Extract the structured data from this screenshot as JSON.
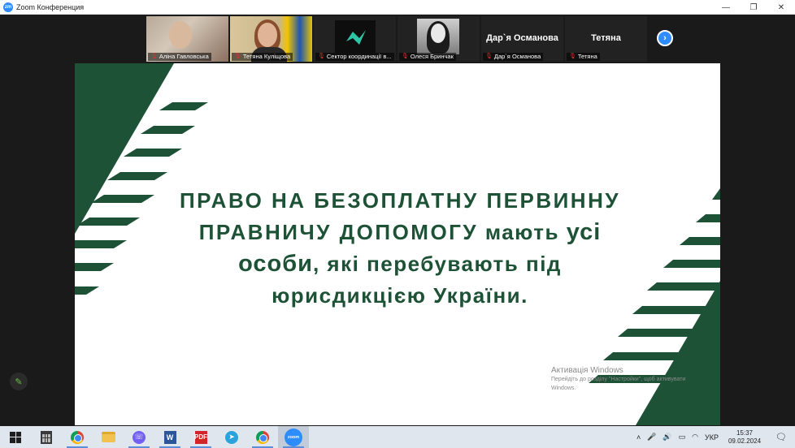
{
  "window": {
    "app_logo": "zm",
    "title": "Zoom Конференция",
    "minimize": "—",
    "restore": "❐",
    "close": "✕"
  },
  "participants": [
    {
      "name": "Аліна Гавловська",
      "muted": true
    },
    {
      "name": "Тетяна Куліщова",
      "muted": true,
      "active_speaker": true
    },
    {
      "name": "Сектор координації в...",
      "muted": true
    },
    {
      "name": "Олеся Бринчак",
      "muted": true
    },
    {
      "name": "Дар`я Османова",
      "display": "Дар`я Османова",
      "muted": true
    },
    {
      "name": "Тетяна",
      "display": "Тетяна",
      "muted": true
    }
  ],
  "strip_next": "›",
  "slide": {
    "line1": "ПРАВО НА БЕЗОПЛАТНУ ПЕРВИННУ",
    "line2_a": "ПРАВНИЧУ ДОПОМОГУ",
    "line2_b": " мають ",
    "line2_c": "усі",
    "line3_a": "особи",
    "line3_b": ", які перебувають під",
    "line4": "юрисдикцією України.",
    "accent_color": "#1e5236"
  },
  "activation": {
    "title": "Активація Windows",
    "subtitle": "Перейдіть до розділу \"Настройки\", щоб активувати Windows."
  },
  "annotate_icon": "✎",
  "taskbar": {
    "apps": [
      "start",
      "calculator",
      "chrome",
      "file-explorer",
      "viber",
      "word",
      "acrobat",
      "telegram",
      "chrome",
      "zoom"
    ],
    "word_label": "W",
    "pdf_label": "PDF",
    "zoom_label": "zoom",
    "tray_up": "˄",
    "mic": "🎤",
    "volume": "🔊",
    "battery": "▭",
    "wifi": "◠",
    "language": "УКР",
    "time": "15:37",
    "date": "09.02.2024",
    "notifications": "🗨"
  }
}
